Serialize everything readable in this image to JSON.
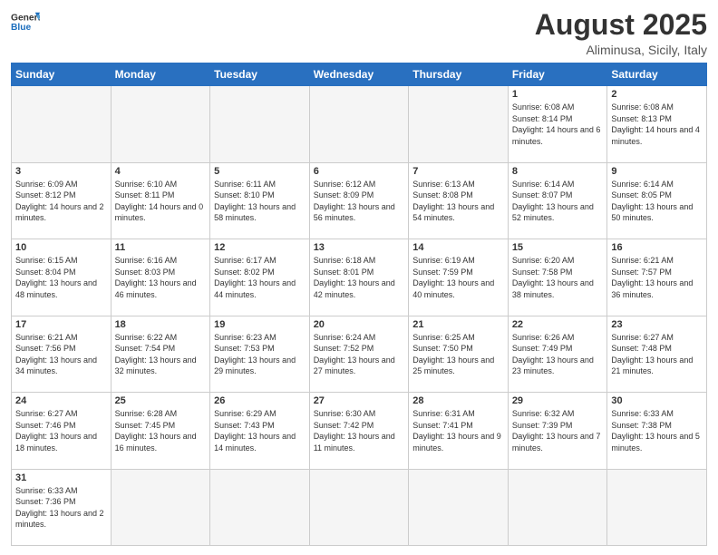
{
  "header": {
    "logo_general": "General",
    "logo_blue": "Blue",
    "month_title": "August 2025",
    "location": "Aliminusa, Sicily, Italy"
  },
  "days_of_week": [
    "Sunday",
    "Monday",
    "Tuesday",
    "Wednesday",
    "Thursday",
    "Friday",
    "Saturday"
  ],
  "weeks": [
    [
      {
        "day": "",
        "info": ""
      },
      {
        "day": "",
        "info": ""
      },
      {
        "day": "",
        "info": ""
      },
      {
        "day": "",
        "info": ""
      },
      {
        "day": "",
        "info": ""
      },
      {
        "day": "1",
        "info": "Sunrise: 6:08 AM\nSunset: 8:14 PM\nDaylight: 14 hours and 6 minutes."
      },
      {
        "day": "2",
        "info": "Sunrise: 6:08 AM\nSunset: 8:13 PM\nDaylight: 14 hours and 4 minutes."
      }
    ],
    [
      {
        "day": "3",
        "info": "Sunrise: 6:09 AM\nSunset: 8:12 PM\nDaylight: 14 hours and 2 minutes."
      },
      {
        "day": "4",
        "info": "Sunrise: 6:10 AM\nSunset: 8:11 PM\nDaylight: 14 hours and 0 minutes."
      },
      {
        "day": "5",
        "info": "Sunrise: 6:11 AM\nSunset: 8:10 PM\nDaylight: 13 hours and 58 minutes."
      },
      {
        "day": "6",
        "info": "Sunrise: 6:12 AM\nSunset: 8:09 PM\nDaylight: 13 hours and 56 minutes."
      },
      {
        "day": "7",
        "info": "Sunrise: 6:13 AM\nSunset: 8:08 PM\nDaylight: 13 hours and 54 minutes."
      },
      {
        "day": "8",
        "info": "Sunrise: 6:14 AM\nSunset: 8:07 PM\nDaylight: 13 hours and 52 minutes."
      },
      {
        "day": "9",
        "info": "Sunrise: 6:14 AM\nSunset: 8:05 PM\nDaylight: 13 hours and 50 minutes."
      }
    ],
    [
      {
        "day": "10",
        "info": "Sunrise: 6:15 AM\nSunset: 8:04 PM\nDaylight: 13 hours and 48 minutes."
      },
      {
        "day": "11",
        "info": "Sunrise: 6:16 AM\nSunset: 8:03 PM\nDaylight: 13 hours and 46 minutes."
      },
      {
        "day": "12",
        "info": "Sunrise: 6:17 AM\nSunset: 8:02 PM\nDaylight: 13 hours and 44 minutes."
      },
      {
        "day": "13",
        "info": "Sunrise: 6:18 AM\nSunset: 8:01 PM\nDaylight: 13 hours and 42 minutes."
      },
      {
        "day": "14",
        "info": "Sunrise: 6:19 AM\nSunset: 7:59 PM\nDaylight: 13 hours and 40 minutes."
      },
      {
        "day": "15",
        "info": "Sunrise: 6:20 AM\nSunset: 7:58 PM\nDaylight: 13 hours and 38 minutes."
      },
      {
        "day": "16",
        "info": "Sunrise: 6:21 AM\nSunset: 7:57 PM\nDaylight: 13 hours and 36 minutes."
      }
    ],
    [
      {
        "day": "17",
        "info": "Sunrise: 6:21 AM\nSunset: 7:56 PM\nDaylight: 13 hours and 34 minutes."
      },
      {
        "day": "18",
        "info": "Sunrise: 6:22 AM\nSunset: 7:54 PM\nDaylight: 13 hours and 32 minutes."
      },
      {
        "day": "19",
        "info": "Sunrise: 6:23 AM\nSunset: 7:53 PM\nDaylight: 13 hours and 29 minutes."
      },
      {
        "day": "20",
        "info": "Sunrise: 6:24 AM\nSunset: 7:52 PM\nDaylight: 13 hours and 27 minutes."
      },
      {
        "day": "21",
        "info": "Sunrise: 6:25 AM\nSunset: 7:50 PM\nDaylight: 13 hours and 25 minutes."
      },
      {
        "day": "22",
        "info": "Sunrise: 6:26 AM\nSunset: 7:49 PM\nDaylight: 13 hours and 23 minutes."
      },
      {
        "day": "23",
        "info": "Sunrise: 6:27 AM\nSunset: 7:48 PM\nDaylight: 13 hours and 21 minutes."
      }
    ],
    [
      {
        "day": "24",
        "info": "Sunrise: 6:27 AM\nSunset: 7:46 PM\nDaylight: 13 hours and 18 minutes."
      },
      {
        "day": "25",
        "info": "Sunrise: 6:28 AM\nSunset: 7:45 PM\nDaylight: 13 hours and 16 minutes."
      },
      {
        "day": "26",
        "info": "Sunrise: 6:29 AM\nSunset: 7:43 PM\nDaylight: 13 hours and 14 minutes."
      },
      {
        "day": "27",
        "info": "Sunrise: 6:30 AM\nSunset: 7:42 PM\nDaylight: 13 hours and 11 minutes."
      },
      {
        "day": "28",
        "info": "Sunrise: 6:31 AM\nSunset: 7:41 PM\nDaylight: 13 hours and 9 minutes."
      },
      {
        "day": "29",
        "info": "Sunrise: 6:32 AM\nSunset: 7:39 PM\nDaylight: 13 hours and 7 minutes."
      },
      {
        "day": "30",
        "info": "Sunrise: 6:33 AM\nSunset: 7:38 PM\nDaylight: 13 hours and 5 minutes."
      }
    ],
    [
      {
        "day": "31",
        "info": "Sunrise: 6:33 AM\nSunset: 7:36 PM\nDaylight: 13 hours and 2 minutes."
      },
      {
        "day": "",
        "info": ""
      },
      {
        "day": "",
        "info": ""
      },
      {
        "day": "",
        "info": ""
      },
      {
        "day": "",
        "info": ""
      },
      {
        "day": "",
        "info": ""
      },
      {
        "day": "",
        "info": ""
      }
    ]
  ]
}
